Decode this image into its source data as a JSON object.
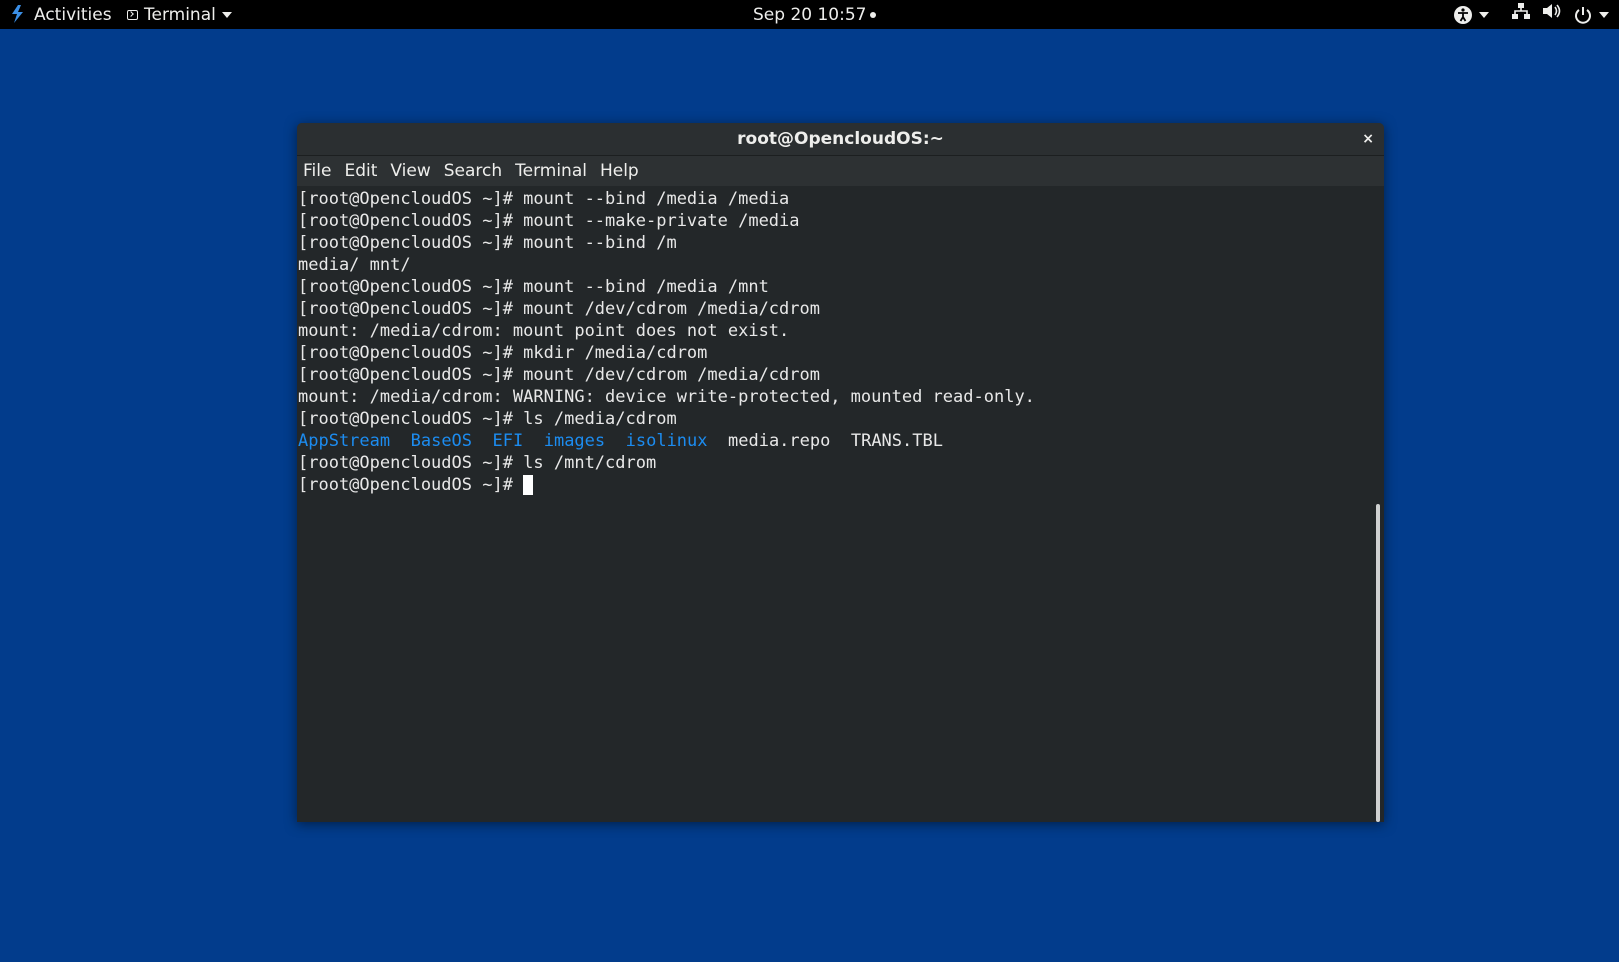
{
  "topbar": {
    "activities": "Activities",
    "app_menu": "Terminal",
    "clock": "Sep 20  10:57"
  },
  "window": {
    "title": "root@OpencloudOS:~",
    "close": "×",
    "menu": [
      "File",
      "Edit",
      "View",
      "Search",
      "Terminal",
      "Help"
    ]
  },
  "terminal": {
    "lines": [
      "[root@OpencloudOS ~]# mount --bind /media /media",
      "[root@OpencloudOS ~]# mount --make-private /media",
      "[root@OpencloudOS ~]# mount --bind /m",
      "media/ mnt/",
      "[root@OpencloudOS ~]# mount --bind /media /mnt",
      "[root@OpencloudOS ~]# mount /dev/cdrom /media/cdrom",
      "mount: /media/cdrom: mount point does not exist.",
      "[root@OpencloudOS ~]# mkdir /media/cdrom",
      "[root@OpencloudOS ~]# mount /dev/cdrom /media/cdrom",
      "mount: /media/cdrom: WARNING: device write-protected, mounted read-only.",
      "[root@OpencloudOS ~]# ls /media/cdrom"
    ],
    "ls_output": {
      "dirs": [
        "AppStream",
        "BaseOS",
        "EFI",
        "images",
        "isolinux"
      ],
      "files": [
        "media.repo",
        "TRANS.TBL"
      ]
    },
    "after_lines": [
      "[root@OpencloudOS ~]# ls /mnt/cdrom"
    ],
    "prompt": "[root@OpencloudOS ~]# ",
    "dir_color": "#1c8cf0"
  },
  "colors": {
    "desktop": "#023c8c",
    "topbar": "#000000",
    "terminal_bg": "#232729"
  }
}
